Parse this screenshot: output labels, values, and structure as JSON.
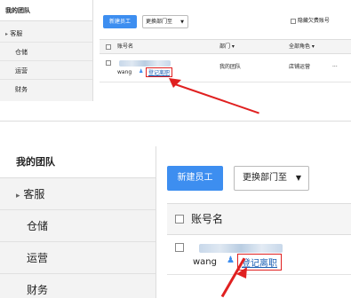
{
  "top": {
    "sidebar": {
      "title": "我的团队",
      "items": [
        {
          "label": "客服",
          "arrow": "▸"
        },
        {
          "label": "仓储"
        },
        {
          "label": "运营"
        },
        {
          "label": "财务"
        }
      ]
    },
    "toolbar": {
      "new_employee": "新建员工",
      "change_dept": "更换部门至",
      "hide_label": "隐藏欠费账号"
    },
    "table": {
      "headers": [
        "账号名",
        "部门",
        "全部角色"
      ],
      "row": {
        "name": "wang",
        "action": "登记离职",
        "dept": "我的团队",
        "role": "店铺运营",
        "more": "..."
      }
    }
  },
  "bottom": {
    "sidebar": {
      "title": "我的团队",
      "items": [
        {
          "label": "客服",
          "arrow": "▸"
        },
        {
          "label": "仓储"
        },
        {
          "label": "运营"
        },
        {
          "label": "财务"
        }
      ]
    },
    "toolbar": {
      "new_employee": "新建员工",
      "change_dept": "更换部门至"
    },
    "table": {
      "header": "账号名",
      "row": {
        "name": "wang",
        "action": "登记离职"
      }
    }
  },
  "colors": {
    "accent": "#3d8ef0",
    "highlight": "#e02020"
  },
  "icons": [
    "checkbox-icon",
    "dropdown-caret-icon",
    "person-icon",
    "red-arrow-icon",
    "expand-arrow-icon"
  ]
}
